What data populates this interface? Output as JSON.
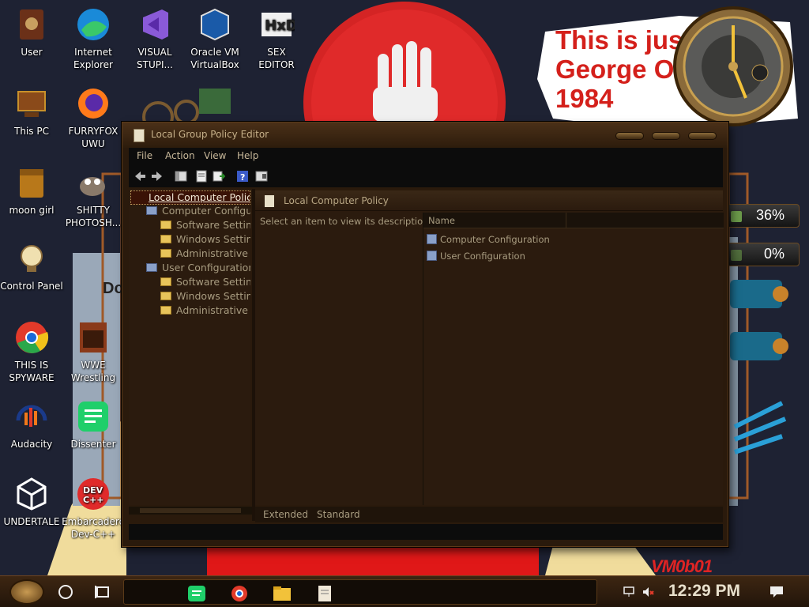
{
  "wallpaper": {
    "meme_text": "This is just li\nGeorge Orwells\n1984",
    "vmobot": "VM0b01",
    "partial_text": "Do",
    "gauges": [
      {
        "label": "36%",
        "level": 0.36
      },
      {
        "label": "0%",
        "level": 0.0
      }
    ],
    "colors": {
      "accent_red": "#d4201b",
      "bg": "#1e2233",
      "bronze": "#6b4220"
    }
  },
  "desktop_icons": [
    {
      "id": "user",
      "label": "User",
      "icon": "user-folder-icon"
    },
    {
      "id": "ie",
      "label": "Internet\nExplorer",
      "icon": "edge-icon"
    },
    {
      "id": "vs",
      "label": "VISUAL\nSTUPI...",
      "icon": "visual-studio-icon"
    },
    {
      "id": "vbox",
      "label": "Oracle VM\nVirtualBox",
      "icon": "virtualbox-icon"
    },
    {
      "id": "hxd",
      "label": "SEX\nEDITOR",
      "icon": "hxd-icon"
    },
    {
      "id": "thispc",
      "label": "This PC",
      "icon": "computer-icon"
    },
    {
      "id": "firefox",
      "label": "FURRYFOX\nUWU",
      "icon": "firefox-icon"
    },
    {
      "id": "moongirl",
      "label": "moon girl",
      "icon": "folder-icon"
    },
    {
      "id": "gimp",
      "label": "SHITTY\nPHOTOSH...",
      "icon": "gimp-icon"
    },
    {
      "id": "cpanel",
      "label": "Control Panel",
      "icon": "lightbulb-icon"
    },
    {
      "id": "chrome",
      "label": "THIS IS\nSPYWARE",
      "icon": "chrome-icon"
    },
    {
      "id": "wwe",
      "label": "WWE\nWrestling",
      "icon": "oven-icon"
    },
    {
      "id": "audacity",
      "label": "Audacity",
      "icon": "audacity-icon"
    },
    {
      "id": "dissenter",
      "label": "Dissenter",
      "icon": "dissenter-icon"
    },
    {
      "id": "unity",
      "label": "UNDERTALE",
      "icon": "unity-icon"
    },
    {
      "id": "devcpp",
      "label": "Embarcadero\nDev-C++",
      "icon": "devcpp-icon"
    }
  ],
  "window": {
    "title": "Local Group Policy Editor",
    "menu": [
      "File",
      "Action",
      "View",
      "Help"
    ],
    "tree": {
      "root": "Local Computer Policy",
      "computer": "Computer Configura",
      "computer_children": [
        "Software Setting",
        "Windows Setting",
        "Administrative T"
      ],
      "user": "User Configuration",
      "user_children": [
        "Software Setting",
        "Windows Setting",
        "Administrative T"
      ]
    },
    "right": {
      "header": "Local Computer Policy",
      "description": "Select an item to view its description.",
      "column_name": "Name",
      "items": [
        "Computer Configuration",
        "User Configuration"
      ]
    },
    "tabs": [
      "Extended",
      "Standard"
    ]
  },
  "taskbar": {
    "time": "12:29 PM",
    "apps": [
      "spotify-icon",
      "chrome-icon",
      "file-explorer-icon",
      "notepad-icon"
    ]
  }
}
